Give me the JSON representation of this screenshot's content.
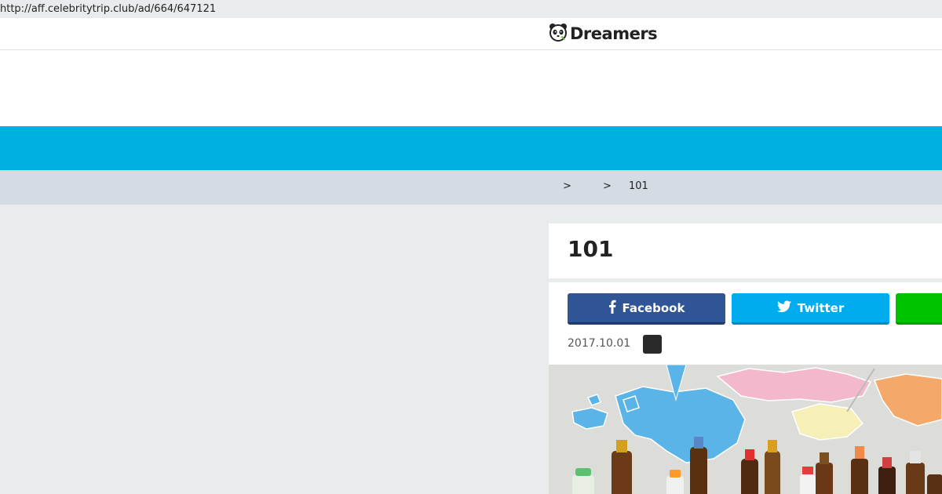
{
  "browser": {
    "url": "http://aff.celebritytrip.club/ad/664/647121"
  },
  "header": {
    "logo_text": "Dreamers"
  },
  "breadcrumb": {
    "sep1": ">",
    "sep2": ">",
    "current": "101"
  },
  "article": {
    "title": "101",
    "date": "2017.10.01",
    "share": {
      "facebook": "Facebook",
      "twitter": "Twitter"
    }
  },
  "colors": {
    "nav": "#00b1e0",
    "facebook": "#2f5597",
    "twitter": "#00aced",
    "line": "#00c300"
  },
  "icons": {
    "logo": "panda-icon",
    "facebook": "facebook-icon",
    "twitter": "twitter-bird-icon"
  }
}
